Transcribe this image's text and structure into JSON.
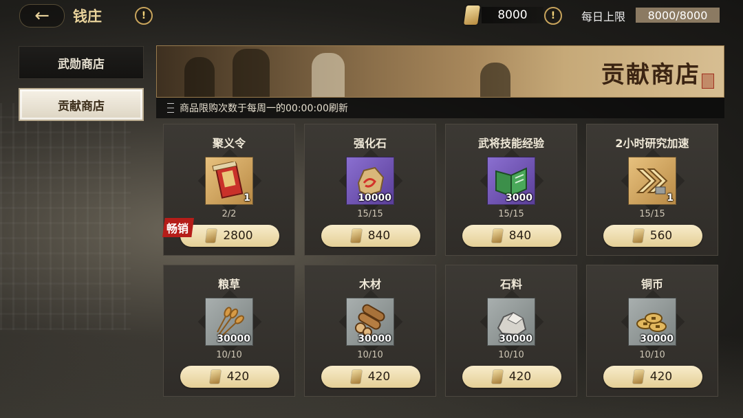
{
  "header": {
    "title": "钱庄",
    "currency_value": "8000",
    "daily_limit_label": "每日上限",
    "daily_limit_value": "8000/8000"
  },
  "tabs": [
    {
      "label": "武勋商店",
      "active": false
    },
    {
      "label": "贡献商店",
      "active": true
    }
  ],
  "banner": {
    "title": "贡献商店"
  },
  "notice": "商品限购次数于每周一的00:00:00刷新",
  "items": [
    {
      "name": "聚义令",
      "count": "1",
      "limit": "2/2",
      "price": "2800",
      "badge": "畅销",
      "quality": "gold",
      "icon": "token-scroll-icon"
    },
    {
      "name": "强化石",
      "count": "10000",
      "limit": "15/15",
      "price": "840",
      "quality": "purple",
      "icon": "ore-stone-icon"
    },
    {
      "name": "武将技能经验",
      "count": "3000",
      "limit": "15/15",
      "price": "840",
      "quality": "purple",
      "icon": "book-icon"
    },
    {
      "name": "2小时研究加速",
      "count": "1",
      "limit": "15/15",
      "price": "560",
      "quality": "gold",
      "icon": "speedup-icon"
    },
    {
      "name": "粮草",
      "count": "30000",
      "limit": "10/10",
      "price": "420",
      "quality": "gray",
      "icon": "wheat-icon"
    },
    {
      "name": "木材",
      "count": "30000",
      "limit": "10/10",
      "price": "420",
      "quality": "gray",
      "icon": "logs-icon"
    },
    {
      "name": "石料",
      "count": "30000",
      "limit": "10/10",
      "price": "420",
      "quality": "gray",
      "icon": "stone-icon"
    },
    {
      "name": "铜币",
      "count": "30000",
      "limit": "10/10",
      "price": "420",
      "quality": "gray",
      "icon": "coins-icon"
    }
  ],
  "colors": {
    "accent_gold": "#e9d39b",
    "hot_badge": "#b51d19",
    "purple_quality": "#6a4fb0",
    "gold_quality": "#d1a762"
  }
}
